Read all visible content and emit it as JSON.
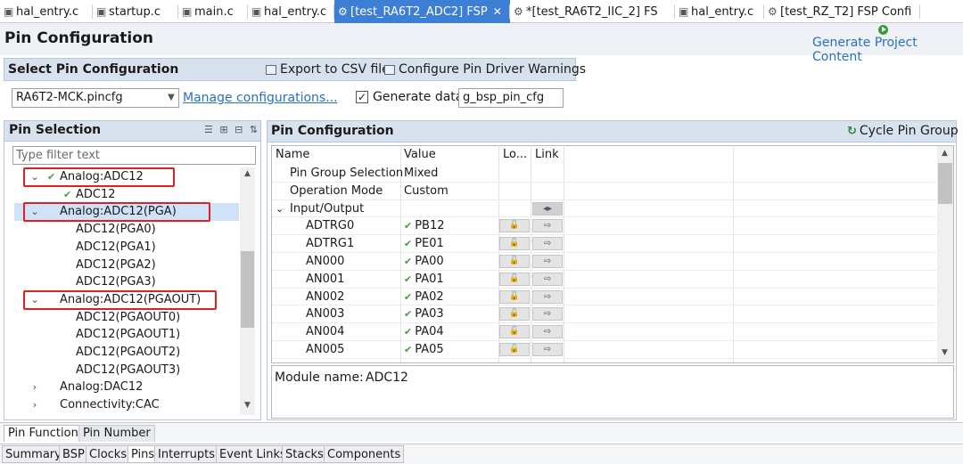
{
  "editor_tabs": [
    {
      "label": "hal_entry.c",
      "icon": "c-file-icon"
    },
    {
      "label": "startup.c",
      "icon": "c-file-icon"
    },
    {
      "label": "main.c",
      "icon": "c-file-icon"
    },
    {
      "label": "hal_entry.c",
      "icon": "c-file-icon"
    },
    {
      "label": "[test_RA6T2_ADC2] FSP",
      "icon": "gear-icon",
      "close": "✕"
    },
    {
      "label": "*[test_RA6T2_IIC_2] FS",
      "icon": "gear-icon"
    },
    {
      "label": "hal_entry.c",
      "icon": "c-file-icon"
    },
    {
      "label": "[test_RZ_T2] FSP Confi",
      "icon": "gear-icon"
    }
  ],
  "header": {
    "title": "Pin Configuration",
    "generate_label": "Generate Project Content"
  },
  "select_config": {
    "title": "Select Pin Configuration",
    "export_label": "Export to CSV file",
    "warnings_label": "Configure Pin Driver Warnings",
    "selected_file": "RA6T2-MCK.pincfg",
    "manage_label": "Manage configurations...",
    "generate_data_label": "Generate data:",
    "generate_data_checked": true,
    "generate_data_value": "g_bsp_pin_cfg"
  },
  "pin_selection": {
    "title": "Pin Selection",
    "filter_placeholder": "Type filter text",
    "tree": [
      {
        "label": "Analog:ADC12",
        "level": 0,
        "expanded": true,
        "checked": true,
        "highlighted": true
      },
      {
        "label": "ADC12",
        "level": 1,
        "checked": true
      },
      {
        "label": "Analog:ADC12(PGA)",
        "level": 0,
        "expanded": true,
        "selected": true,
        "highlighted": true
      },
      {
        "label": "ADC12(PGA0)",
        "level": 1
      },
      {
        "label": "ADC12(PGA1)",
        "level": 1
      },
      {
        "label": "ADC12(PGA2)",
        "level": 1
      },
      {
        "label": "ADC12(PGA3)",
        "level": 1
      },
      {
        "label": "Analog:ADC12(PGAOUT)",
        "level": 0,
        "expanded": true,
        "highlighted": true
      },
      {
        "label": "ADC12(PGAOUT0)",
        "level": 1
      },
      {
        "label": "ADC12(PGAOUT1)",
        "level": 1
      },
      {
        "label": "ADC12(PGAOUT2)",
        "level": 1
      },
      {
        "label": "ADC12(PGAOUT3)",
        "level": 1
      },
      {
        "label": "Analog:DAC12",
        "level": 0,
        "expanded": false
      },
      {
        "label": "Connectivity:CAC",
        "level": 0,
        "expanded": false
      }
    ]
  },
  "pin_config": {
    "title": "Pin Configuration",
    "cycle_label": "Cycle Pin Group",
    "columns": [
      "Name",
      "Value",
      "Lo...",
      "Link"
    ],
    "rows": [
      {
        "name": "Pin Group Selection",
        "value": "Mixed",
        "indent": 1
      },
      {
        "name": "Operation Mode",
        "value": "Custom",
        "indent": 1
      },
      {
        "name": "Input/Output",
        "value": "",
        "indent": 0,
        "group": true
      },
      {
        "name": "ADTRG0",
        "value": "PB12",
        "indent": 2,
        "checked": true
      },
      {
        "name": "ADTRG1",
        "value": "PE01",
        "indent": 2,
        "checked": true
      },
      {
        "name": "AN000",
        "value": "PA00",
        "indent": 2,
        "checked": true
      },
      {
        "name": "AN001",
        "value": "PA01",
        "indent": 2,
        "checked": true
      },
      {
        "name": "AN002",
        "value": "PA02",
        "indent": 2,
        "checked": true
      },
      {
        "name": "AN003",
        "value": "PA03",
        "indent": 2,
        "checked": true
      },
      {
        "name": "AN004",
        "value": "PA04",
        "indent": 2,
        "checked": true
      },
      {
        "name": "AN005",
        "value": "PA05",
        "indent": 2,
        "checked": true
      }
    ],
    "module_label": "Module name:",
    "module_value": "ADC12"
  },
  "sub_tabs": [
    "Pin Function",
    "Pin Number"
  ],
  "config_tabs": [
    "Summary",
    "BSP",
    "Clocks",
    "Pins",
    "Interrupts",
    "Event Links",
    "Stacks",
    "Components"
  ],
  "active_config_tab": "Pins",
  "colors": {
    "accent": "#3c7fd4",
    "link": "#2a6fc2",
    "highlight_box": "#e02020",
    "check": "#4a9a4a"
  }
}
